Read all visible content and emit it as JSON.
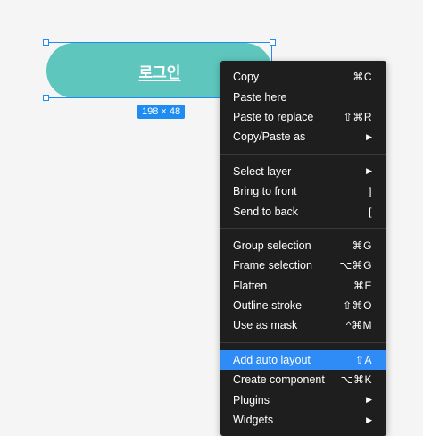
{
  "canvas": {
    "button_label": "로그인",
    "size_badge": "198 × 48",
    "fill_color": "#5ec6bd",
    "selection_color": "#1e8cf0"
  },
  "menu": {
    "groups": [
      [
        {
          "label": "Copy",
          "shortcut": "⌘C"
        },
        {
          "label": "Paste here",
          "shortcut": ""
        },
        {
          "label": "Paste to replace",
          "shortcut": "⇧⌘R"
        },
        {
          "label": "Copy/Paste as",
          "submenu_icon": "chevron-right-icon",
          "submenu_glyph": "▶"
        }
      ],
      [
        {
          "label": "Select layer",
          "submenu_icon": "chevron-right-icon",
          "submenu_glyph": "▶"
        },
        {
          "label": "Bring to front",
          "shortcut": "]"
        },
        {
          "label": "Send to back",
          "shortcut": "["
        }
      ],
      [
        {
          "label": "Group selection",
          "shortcut": "⌘G"
        },
        {
          "label": "Frame selection",
          "shortcut": "⌥⌘G"
        },
        {
          "label": "Flatten",
          "shortcut": "⌘E"
        },
        {
          "label": "Outline stroke",
          "shortcut": "⇧⌘O"
        },
        {
          "label": "Use as mask",
          "shortcut": "^⌘M"
        }
      ],
      [
        {
          "label": "Add auto layout",
          "shortcut": "⇧A",
          "highlighted": true
        },
        {
          "label": "Create component",
          "shortcut": "⌥⌘K"
        },
        {
          "label": "Plugins",
          "submenu_icon": "chevron-right-icon",
          "submenu_glyph": "▶"
        },
        {
          "label": "Widgets",
          "submenu_icon": "chevron-right-icon",
          "submenu_glyph": "▶"
        }
      ]
    ],
    "background_color": "#1e1e1e",
    "highlight_color": "#2f8cf6"
  }
}
